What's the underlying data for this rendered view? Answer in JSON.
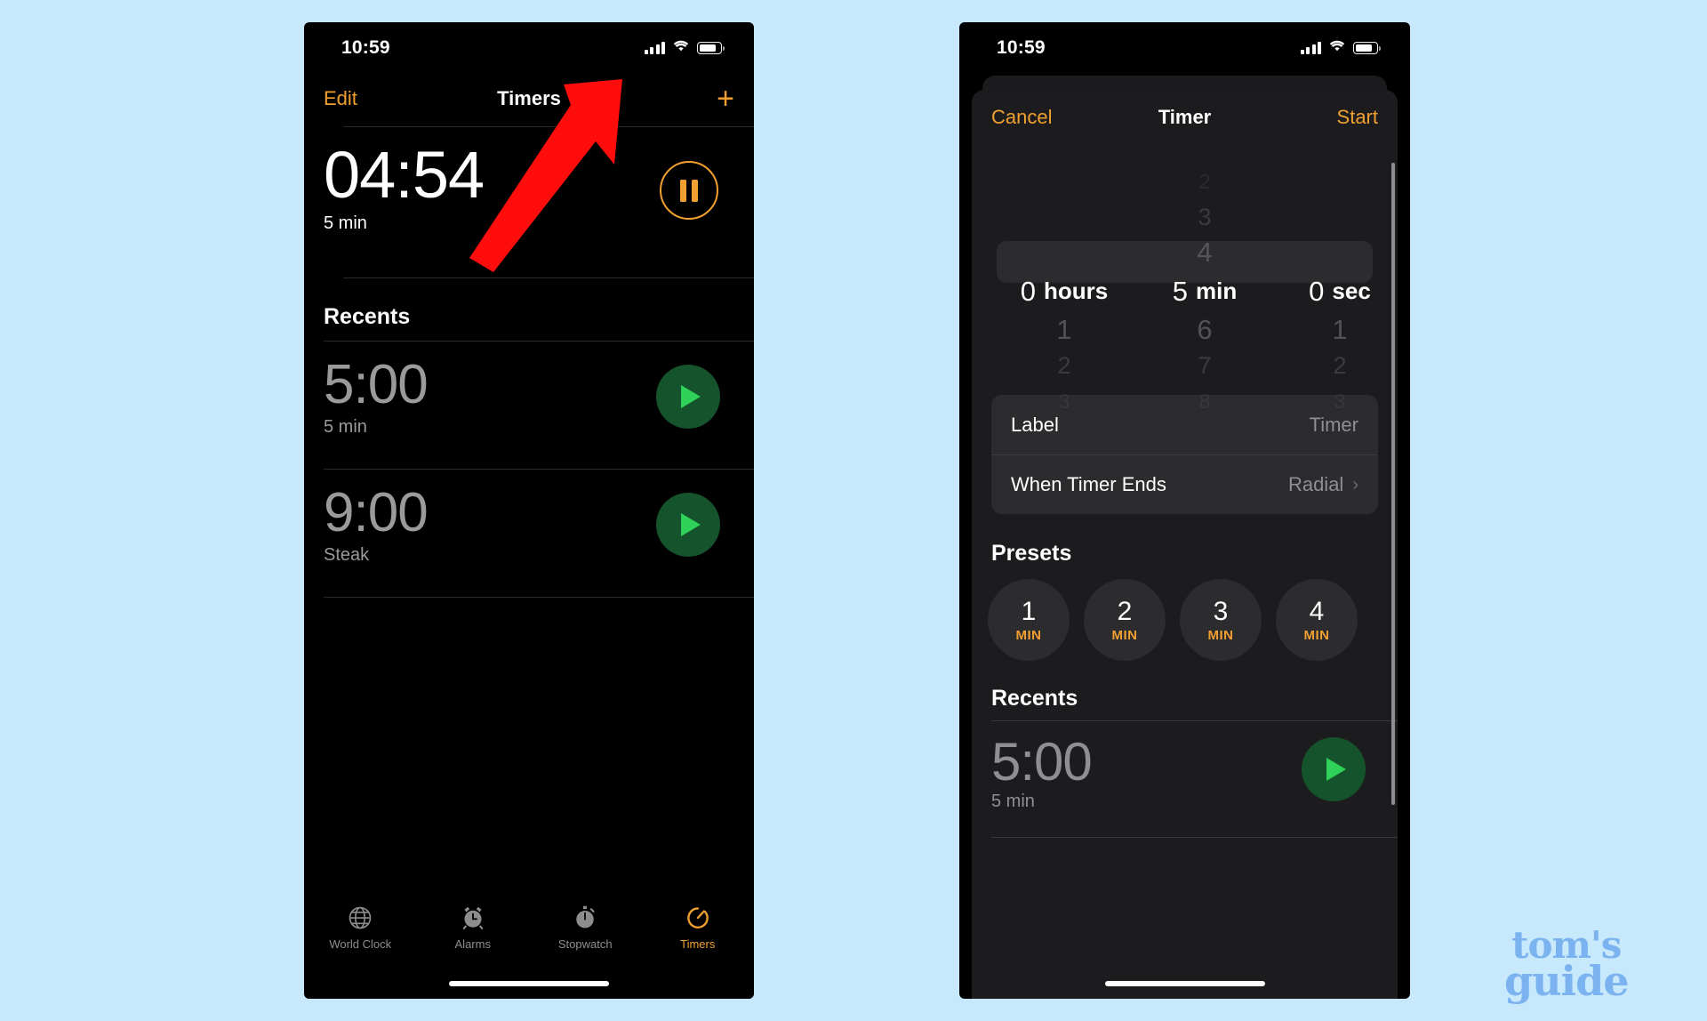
{
  "background_color": "#c8e8fb",
  "accent_orange": "#f0a030",
  "play_green": "#2fd158",
  "arrow_color": "#ff0d0d",
  "watermark": {
    "line1": "tom's",
    "line2": "guide"
  },
  "left_phone": {
    "status": {
      "time": "10:59",
      "cellular_icon": "signal-bars-icon",
      "wifi_icon": "wifi-icon",
      "battery_icon": "battery-icon"
    },
    "nav": {
      "edit_label": "Edit",
      "title": "Timers",
      "add_label": "+"
    },
    "active_timer": {
      "time": "04:54",
      "label": "5 min",
      "control": "pause-icon"
    },
    "recents_header": "Recents",
    "recents": [
      {
        "time": "5:00",
        "label": "5 min",
        "action": "play-icon"
      },
      {
        "time": "9:00",
        "label": "Steak",
        "action": "play-icon"
      }
    ],
    "tabs": [
      {
        "label": "World Clock",
        "icon": "globe-icon",
        "active": false
      },
      {
        "label": "Alarms",
        "icon": "alarm-clock-icon",
        "active": false
      },
      {
        "label": "Stopwatch",
        "icon": "stopwatch-icon",
        "active": false
      },
      {
        "label": "Timers",
        "icon": "timer-icon",
        "active": true
      }
    ]
  },
  "right_phone": {
    "status": {
      "time": "10:59",
      "cellular_icon": "signal-bars-icon",
      "wifi_icon": "wifi-icon",
      "battery_icon": "battery-icon"
    },
    "nav": {
      "cancel_label": "Cancel",
      "title": "Timer",
      "start_label": "Start"
    },
    "picker": {
      "hours": {
        "above": [
          "",
          "",
          ""
        ],
        "selected": "0",
        "unit": "hours",
        "below": [
          "1",
          "2",
          "3"
        ]
      },
      "minutes": {
        "above": [
          "2",
          "3",
          "4"
        ],
        "selected": "5",
        "unit": "min",
        "below": [
          "6",
          "7",
          "8"
        ]
      },
      "seconds": {
        "above": [
          "",
          "",
          ""
        ],
        "selected": "0",
        "unit": "sec",
        "below": [
          "1",
          "2",
          "3"
        ]
      }
    },
    "form_rows": [
      {
        "label": "Label",
        "value": "Timer",
        "chevron": false
      },
      {
        "label": "When Timer Ends",
        "value": "Radial",
        "chevron": true,
        "chevron_glyph": "›"
      }
    ],
    "presets_header": "Presets",
    "presets": [
      {
        "num": "1",
        "unit": "MIN"
      },
      {
        "num": "2",
        "unit": "MIN"
      },
      {
        "num": "3",
        "unit": "MIN"
      },
      {
        "num": "4",
        "unit": "MIN"
      }
    ],
    "recents_header": "Recents",
    "recents": [
      {
        "time": "5:00",
        "label": "5 min",
        "action": "play-icon"
      }
    ]
  }
}
